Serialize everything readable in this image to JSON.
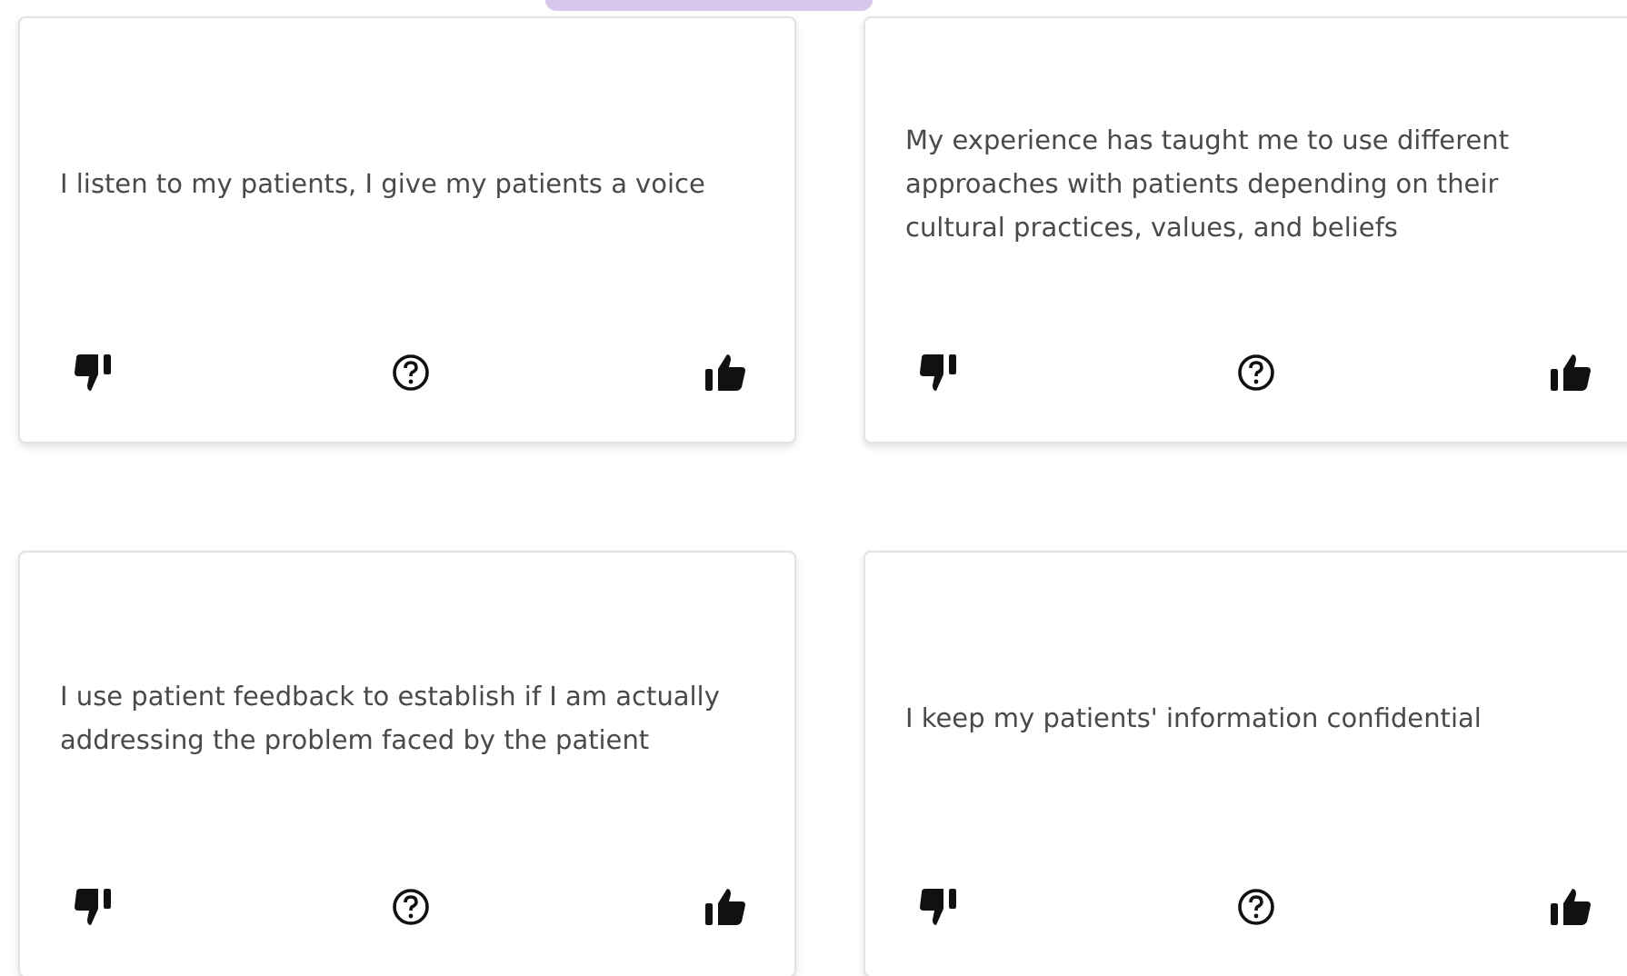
{
  "cards": [
    {
      "text": "I listen to my patients, I give my patients a voice"
    },
    {
      "text": "My experience has taught me to use different approaches with patients depending on their cultural practices, values, and beliefs"
    },
    {
      "text": "I use patient feedback to establish if I am actually addressing the problem faced by the patient"
    },
    {
      "text": "I keep my patients' information confidential"
    }
  ]
}
